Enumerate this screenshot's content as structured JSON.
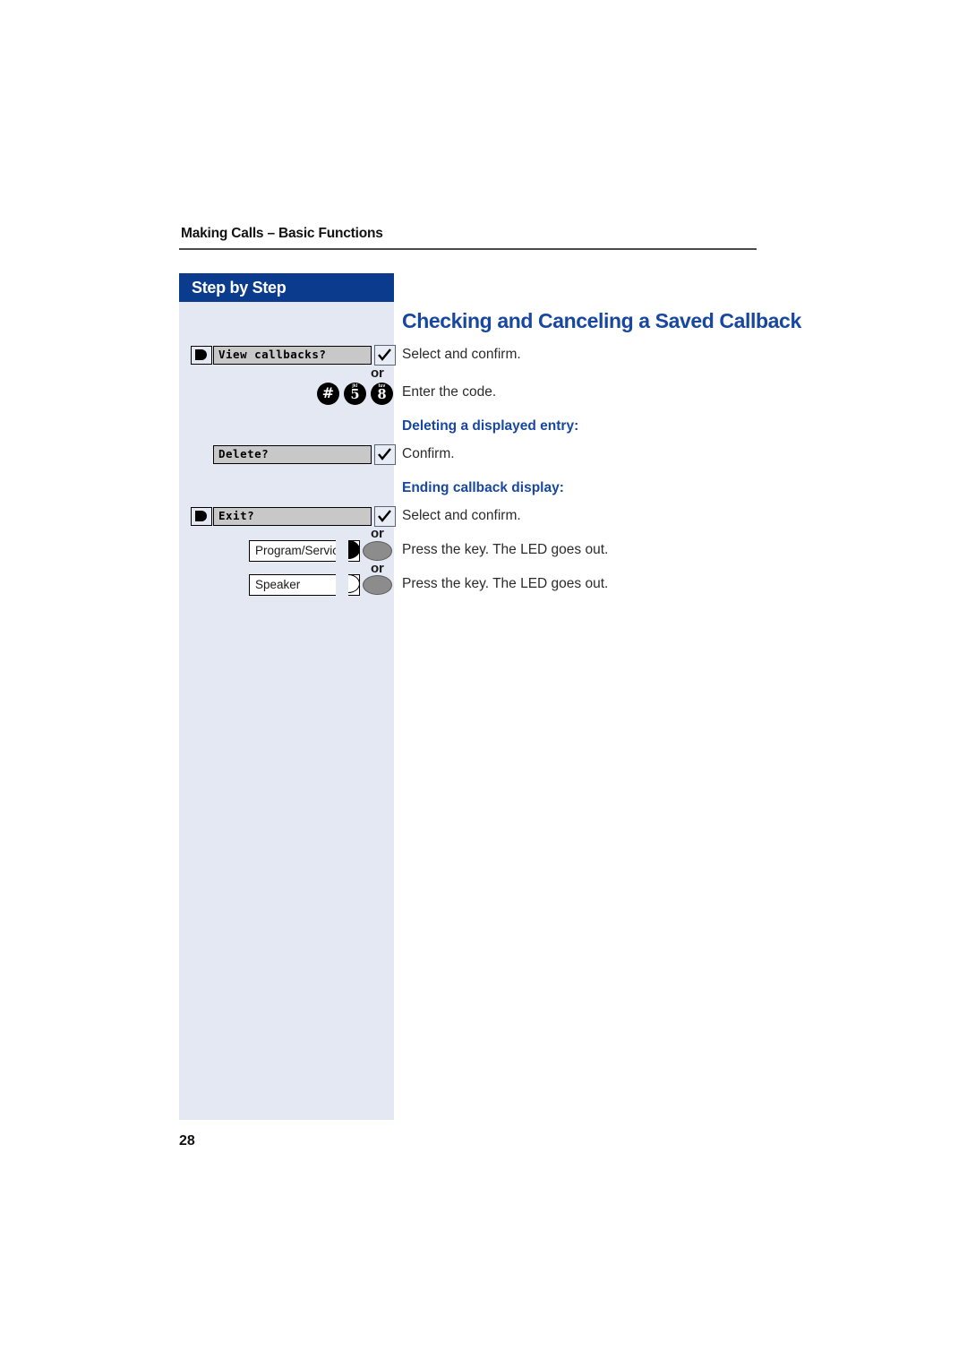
{
  "document": {
    "running_head": "Making Calls – Basic Functions",
    "page_number": "28"
  },
  "sidebar": {
    "header_label": "Step by Step",
    "rows": {
      "view_callbacks": {
        "arrow_icon": "select-arrow-icon",
        "display_text": "View callbacks?",
        "confirm_icon": "checkmark-icon"
      },
      "delete": {
        "display_text": "Delete?",
        "confirm_icon": "checkmark-icon"
      },
      "exit": {
        "arrow_icon": "select-arrow-icon",
        "display_text": "Exit?",
        "confirm_icon": "checkmark-icon"
      }
    },
    "keypad": {
      "keys": [
        {
          "digit": "#",
          "letters": ""
        },
        {
          "digit": "5",
          "letters": "jkl"
        },
        {
          "digit": "8",
          "letters": "tuv"
        }
      ]
    },
    "hardware_keys": [
      {
        "label": "Program/Service",
        "led_state": "filled"
      },
      {
        "label": "Speaker",
        "led_state": "hollow"
      }
    ],
    "separators": {
      "or": "or"
    }
  },
  "main": {
    "title": "Checking and Canceling a Saved Callback",
    "lines": {
      "select_confirm_1": "Select and confirm.",
      "enter_code": "Enter the code.",
      "heading_deleting": "Deleting a displayed entry:",
      "confirm": "Confirm.",
      "heading_ending": "Ending callback display:",
      "select_confirm_2": "Select and confirm.",
      "press_key_1": "Press the key. The LED goes out.",
      "press_key_2": "Press the key. The LED goes out."
    }
  },
  "colors": {
    "brand_blue": "#17479e",
    "header_blue": "#0b3b8c",
    "sidebar_bg": "#e3e8f2",
    "lcd_gray": "#c8c8c8"
  }
}
